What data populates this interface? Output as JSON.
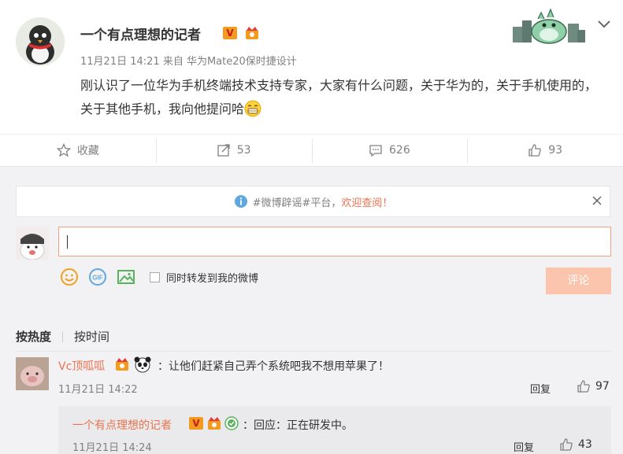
{
  "post": {
    "author": "一个有点理想的记者",
    "verified_badge": "V",
    "meta": "11月21日 14:21 来自 华为Mate20保时捷设计",
    "content": "刚认识了一位华为手机终端技术支持专家，大家有什么问题，关于华为的，关于手机使用的，关于其他手机，我向他提问哈"
  },
  "actions": {
    "favorite": "收藏",
    "repost": "53",
    "comment": "626",
    "like": "93"
  },
  "tip": {
    "prefix": "#微博辟谣#平台，",
    "link": "欢迎查阅！"
  },
  "composer": {
    "checkbox_label": "同时转发到我的微博",
    "submit": "评论"
  },
  "sort": {
    "hot": "按热度",
    "time": "按时间"
  },
  "comment": {
    "name": "Vc顶呱呱",
    "text": "：让他们赶紧自己弄个系统吧我不想用苹果了！",
    "time": "11月21日 14:22",
    "reply": "回复",
    "likes": "97"
  },
  "sub_comment": {
    "name": "一个有点理想的记者",
    "text": "：回应：正在研发中。",
    "time": "11月21日 14:24",
    "reply": "回复",
    "likes": "43"
  },
  "colors": {
    "accent": "#eb7350",
    "muted": "#808080",
    "submit_disabled": "#fbc5ad"
  }
}
